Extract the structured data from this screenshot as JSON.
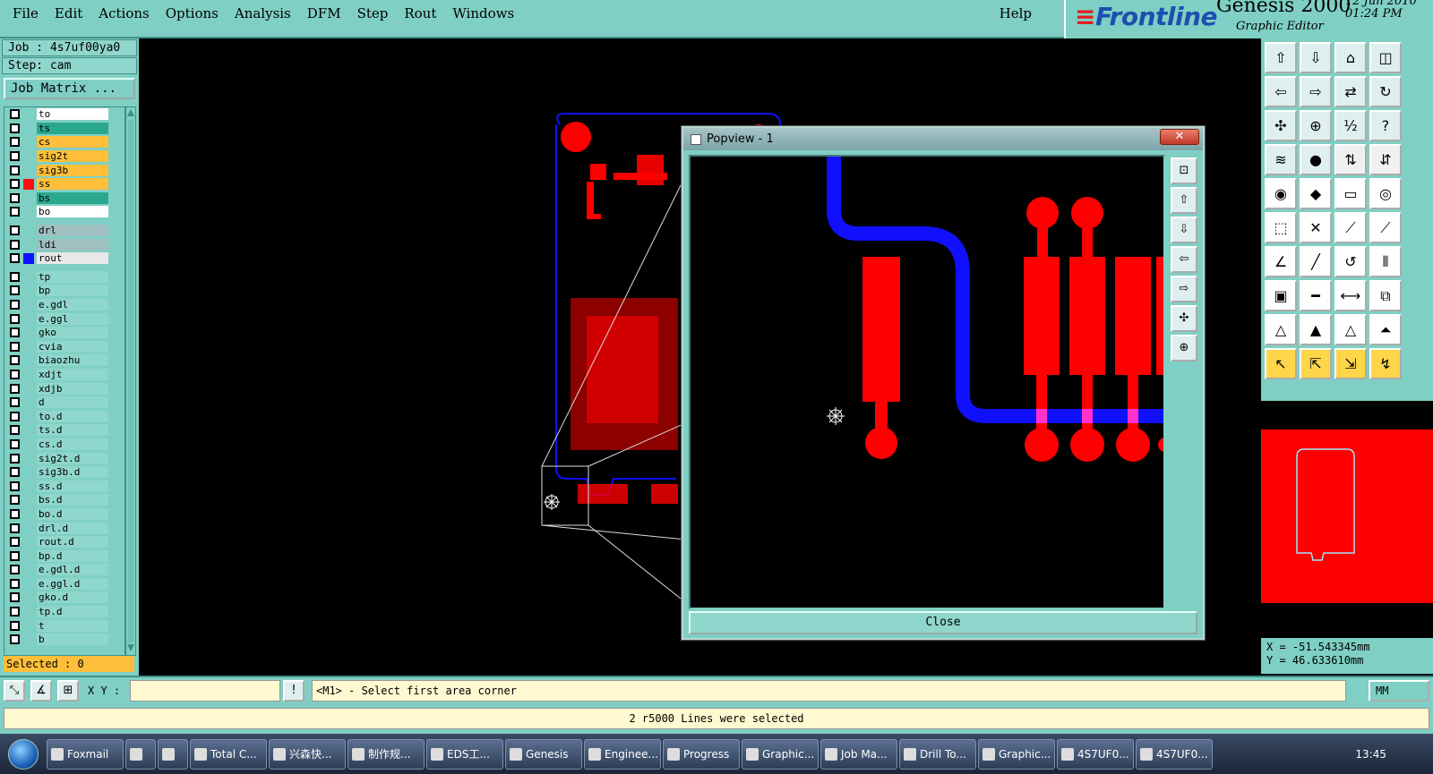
{
  "menubar": {
    "items": [
      "File",
      "Edit",
      "Actions",
      "Options",
      "Analysis",
      "DFM",
      "Step",
      "Rout",
      "Windows"
    ],
    "help": "Help"
  },
  "brand": {
    "logo": "Frontline",
    "product": "Genesis 2000",
    "subtitle": "Graphic Editor",
    "date": "12 Jun 2010",
    "time": "01:24 PM"
  },
  "job": {
    "job_line": "Job : 4s7uf00ya0",
    "step_line": "Step: cam",
    "matrix_button": "Job Matrix ..."
  },
  "layers": {
    "board": [
      {
        "name": "to",
        "color": "#ffffff"
      },
      {
        "name": "ts",
        "color": "#2aa88f"
      },
      {
        "name": "cs",
        "color": "#ffbf3a"
      },
      {
        "name": "sig2t",
        "color": "#ffbf3a"
      },
      {
        "name": "sig3b",
        "color": "#ffbf3a"
      },
      {
        "name": "ss",
        "color": "#ffbf3a",
        "active": true,
        "swatch": "#ff1010"
      },
      {
        "name": "bs",
        "color": "#2aa88f"
      },
      {
        "name": "bo",
        "color": "#ffffff"
      }
    ],
    "drill": [
      {
        "name": "drl",
        "color": "#9fbfc0"
      },
      {
        "name": "ldi",
        "color": "#9fbfc0"
      },
      {
        "name": "rout",
        "color": "#e8e8e8",
        "swatch": "#1010ff"
      }
    ],
    "misc": [
      "tp",
      "bp",
      "e.gdl",
      "e.ggl",
      "gko",
      "cvia",
      "biaozhu",
      "xdjt",
      "xdjb",
      "d",
      "to.d",
      "ts.d",
      "cs.d",
      "sig2t.d",
      "sig3b.d",
      "ss.d",
      "bs.d",
      "bo.d",
      "drl.d",
      "rout.d",
      "bp.d",
      "e.gdl.d",
      "e.ggl.d",
      "gko.d",
      "tp.d",
      "t",
      "b"
    ]
  },
  "selected": "Selected : 0",
  "popview": {
    "title": "Popview - 1",
    "close_label": "Close",
    "x_label": "✕"
  },
  "coords": {
    "x": "X = -51.543345mm",
    "y": "Y =  46.633610mm"
  },
  "command": {
    "xy_label": "X Y :",
    "xy_value": "",
    "prompt": "<M1> - Select first area corner",
    "unit": "MM"
  },
  "status": "2 r5000 Lines were selected",
  "taskbar": {
    "items": [
      "Foxmail",
      "",
      "",
      "Total C...",
      "兴森快...",
      "制作规...",
      "EDS工...",
      "Genesis",
      "Enginee...",
      "Progress",
      "Graphic...",
      "Job Ma...",
      "Drill To...",
      "Graphic...",
      "4S7UF0...",
      "4S7UF0..."
    ],
    "clock": "13:45"
  },
  "colors": {
    "panel": "#7fcfc4",
    "copper": "#ff0000",
    "rout": "#0000ff"
  }
}
